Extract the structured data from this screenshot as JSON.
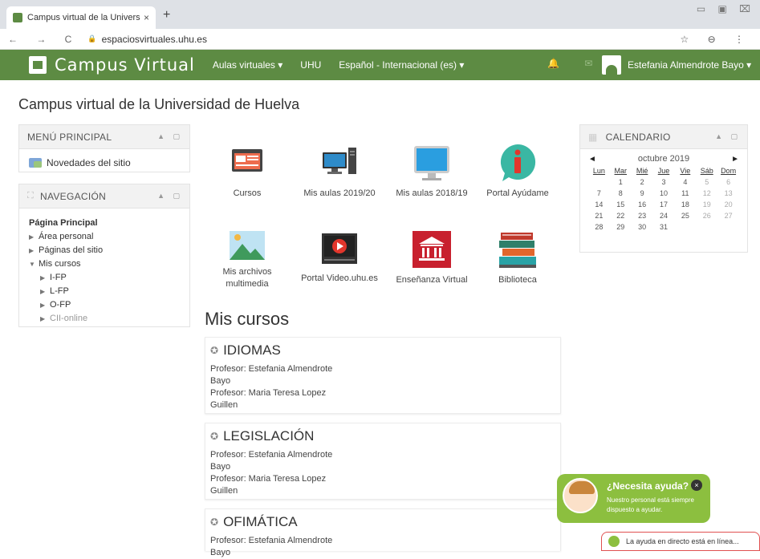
{
  "browser": {
    "tab_title": "Campus virtual de la Universidad",
    "tab_close": "×",
    "new_tab": "+",
    "url": "espaciosvirtuales.uhu.es",
    "nav_glyphs": "← → C",
    "right_glyphs": "☆ ⊖ ⋮",
    "window_controls": "▭ ▣ ⌧"
  },
  "navbar": {
    "brand": "Campus Virtual",
    "menu_aulas": "Aulas virtuales ▾",
    "menu_uhu": "UHU",
    "menu_lang": "Español - Internacional (es) ▾",
    "icons": "🔔 ✉",
    "user": "Estefania Almendrote Bayo ▾"
  },
  "page_title": "Campus virtual de la Universidad de Huelva",
  "menu_principal": {
    "title": "MENÚ PRINCIPAL",
    "ctl": "▲ ▢",
    "item": "Novedades del sitio"
  },
  "navegacion": {
    "title": "NAVEGACIÓN",
    "ctl": "▲ ▢",
    "root": "Página Principal",
    "items": [
      "Área personal",
      "Páginas del sitio",
      "Mis cursos"
    ],
    "sub": [
      "I-FP",
      "L-FP",
      "O-FP",
      "CII-online"
    ]
  },
  "calendar": {
    "title": "CALENDARIO",
    "ctl": "▲ ▢",
    "month": "octubre 2019",
    "prev": "◄",
    "next": "►",
    "days": [
      "Lun",
      "Mar",
      "Mié",
      "Jue",
      "Vie",
      "Sáb",
      "Dom"
    ],
    "weeks": [
      [
        "",
        "1",
        "2",
        "3",
        "4",
        "5",
        "6"
      ],
      [
        "7",
        "8",
        "9",
        "10",
        "11",
        "12",
        "13"
      ],
      [
        "14",
        "15",
        "16",
        "17",
        "18",
        "19",
        "20"
      ],
      [
        "21",
        "22",
        "23",
        "24",
        "25",
        "26",
        "27"
      ],
      [
        "28",
        "29",
        "30",
        "31",
        "",
        "",
        ""
      ]
    ]
  },
  "icons": [
    {
      "label": "Cursos"
    },
    {
      "label": "Mis aulas 2019/20"
    },
    {
      "label": "Mis aulas 2018/19"
    },
    {
      "label": "Portal Ayúdame"
    },
    {
      "label": "Mis archivos multimedia"
    },
    {
      "label": "Portal Video.uhu.es"
    },
    {
      "label": "Enseñanza Virtual"
    },
    {
      "label": "Biblioteca"
    }
  ],
  "mis_cursos_title": "Mis cursos",
  "courses": [
    {
      "name": "IDIOMAS",
      "prof1": "Profesor: Estefania Almendrote Bayo",
      "prof2": "Profesor: Maria Teresa Lopez Guillen"
    },
    {
      "name": "LEGISLACIÓN",
      "prof1": "Profesor: Estefania Almendrote Bayo",
      "prof2": "Profesor: Maria Teresa Lopez Guillen"
    },
    {
      "name": "OFIMÁTICA",
      "prof1": "Profesor: Estefania Almendrote Bayo",
      "prof2": ""
    }
  ],
  "help": {
    "title": "¿Necesita ayuda?",
    "close": "×",
    "text": "Nuestro personal está siempre dispuesto a ayudar.",
    "live": "La ayuda en directo está en línea..."
  },
  "colors": {
    "brand_green": "#5d8b43",
    "help_green": "#8cbf3f"
  }
}
